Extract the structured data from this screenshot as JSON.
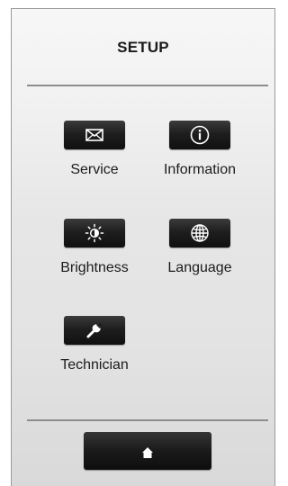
{
  "header": {
    "title": "SETUP"
  },
  "menu": {
    "items": [
      {
        "label": "Service",
        "icon": "envelope-icon"
      },
      {
        "label": "Information",
        "icon": "info-icon"
      },
      {
        "label": "Brightness",
        "icon": "brightness-icon"
      },
      {
        "label": "Language",
        "icon": "globe-icon"
      },
      {
        "label": "Technician",
        "icon": "wrench-icon"
      }
    ]
  },
  "footer": {
    "home_icon": "home-icon"
  },
  "colors": {
    "button_dark": "#1a1a1a",
    "rule": "#8d8d8d",
    "text": "#1c1c1c"
  }
}
